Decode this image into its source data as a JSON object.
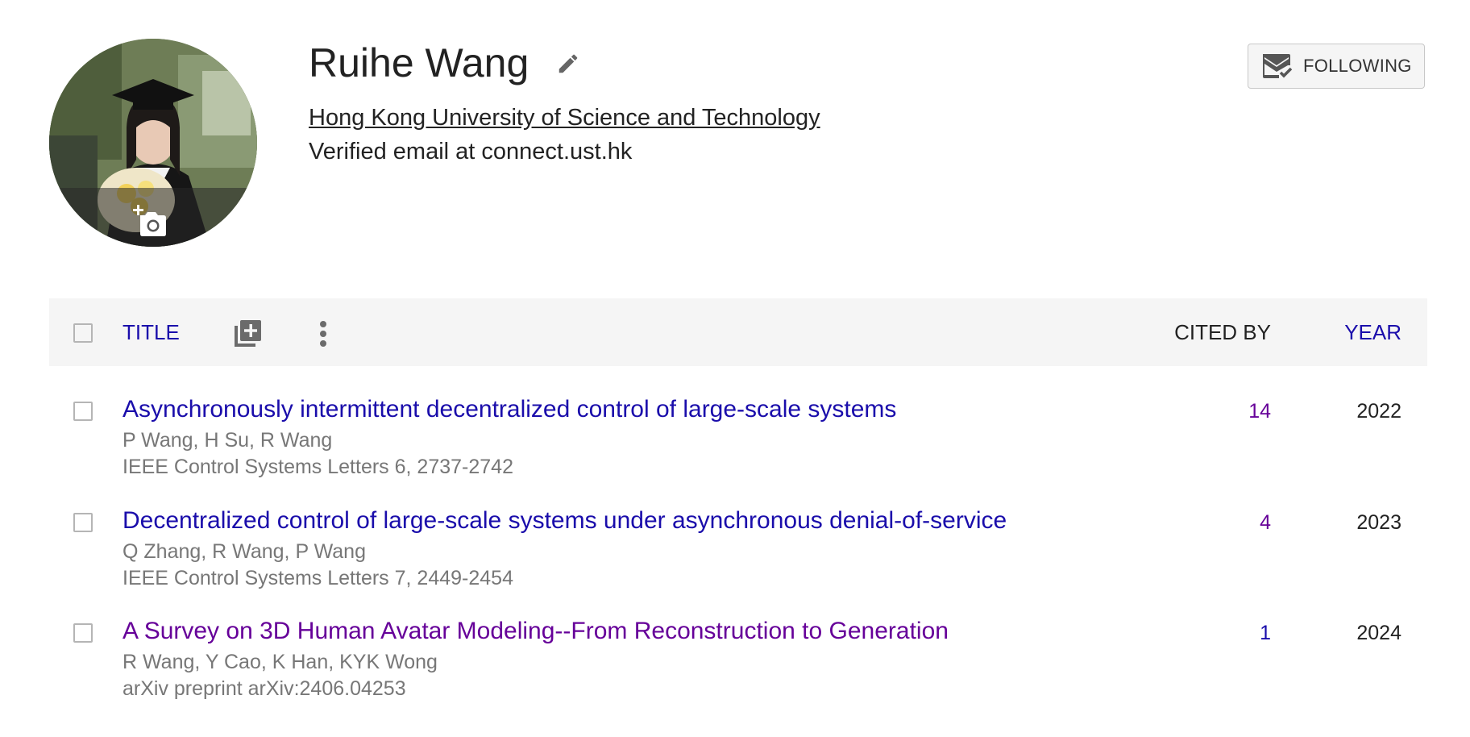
{
  "profile": {
    "name": "Ruihe Wang",
    "affiliation": "Hong Kong University of Science and Technology",
    "email": "Verified email at connect.ust.hk",
    "follow_label": "FOLLOWING"
  },
  "table": {
    "headers": {
      "title": "TITLE",
      "cited_by": "CITED BY",
      "year": "YEAR"
    },
    "rows": [
      {
        "title": "Asynchronously intermittent decentralized control of large-scale systems",
        "authors": "P Wang, H Su, R Wang",
        "venue": "IEEE Control Systems Letters 6, 2737-2742",
        "cited_by": "14",
        "year": "2022"
      },
      {
        "title": "Decentralized control of large-scale systems under asynchronous denial-of-service",
        "authors": "Q Zhang, R Wang, P Wang",
        "venue": "IEEE Control Systems Letters 7, 2449-2454",
        "cited_by": "4",
        "year": "2023"
      },
      {
        "title": "A Survey on 3D Human Avatar Modeling--From Reconstruction to Generation",
        "authors": "R Wang, Y Cao, K Han, KYK Wong",
        "venue": "arXiv preprint arXiv:2406.04253",
        "cited_by": "1",
        "year": "2024"
      }
    ]
  },
  "colors": {
    "link": "#1a0dab",
    "visited": "#660099",
    "meta": "#777777",
    "header_bg": "#f5f5f5"
  },
  "icons": [
    "camera-add-icon",
    "pencil-icon",
    "mail-check-icon",
    "add-to-library-icon",
    "more-vert-icon"
  ]
}
